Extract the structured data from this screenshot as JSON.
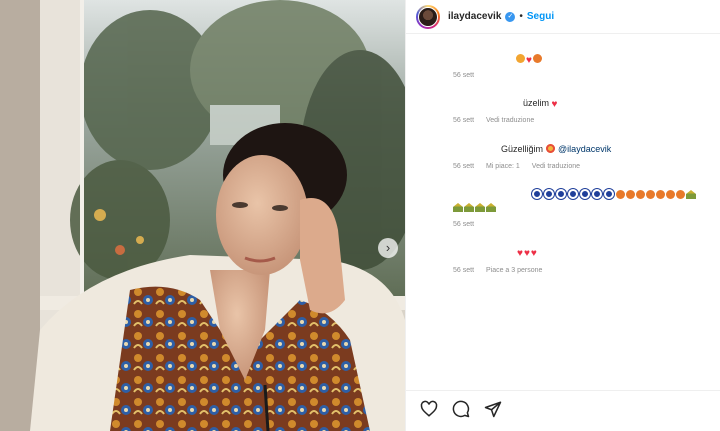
{
  "post": {
    "username": "ilaydacevik",
    "follow_label": "Segui",
    "separator": "•"
  },
  "comments": [
    {
      "text": "",
      "time": "56 sett",
      "emojis": [
        "grin",
        "heart",
        "fire"
      ]
    },
    {
      "text": "üzelim",
      "time": "56 sett",
      "translate": "Vedi traduzione",
      "emojis": [
        "heart"
      ]
    },
    {
      "text": "Güzelliğim",
      "mention": "@ilaydacevik",
      "time": "56 sett",
      "likes": "Mi piace: 1",
      "translate": "Vedi traduzione",
      "emojis": [
        "star-struck"
      ]
    },
    {
      "text": "",
      "time": "56 sett",
      "emojis": [
        "evil-eye x7",
        "pouting x7",
        "house x5"
      ]
    },
    {
      "text": "",
      "time": "56 sett",
      "likes": "Piace a 3 persone",
      "emojis": [
        "heart x3"
      ]
    }
  ],
  "actions": {
    "like_icon": "heart-outline",
    "comment_icon": "speech-bubble",
    "share_icon": "paper-plane"
  },
  "colors": {
    "accent": "#0095f6",
    "heart": "#ed2f46",
    "meta": "#8e8e8e",
    "mention": "#00376b"
  }
}
